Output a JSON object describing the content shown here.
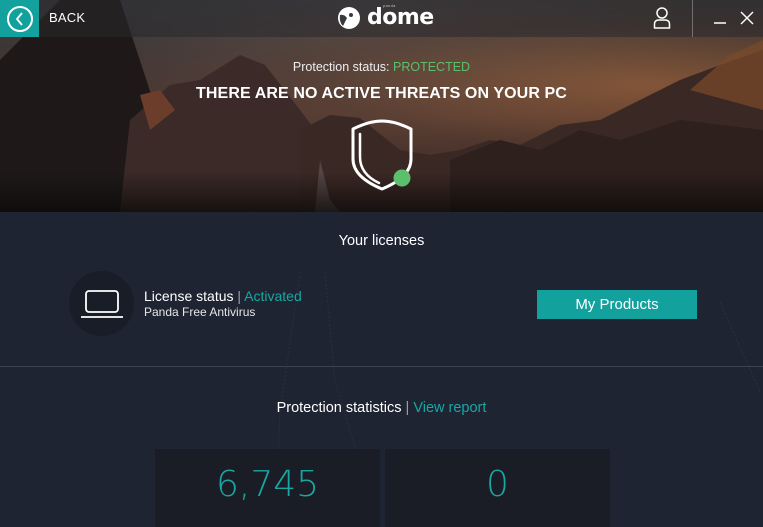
{
  "titlebar": {
    "back_label": "BACK",
    "logo_sub": "panda",
    "logo_text": "dome",
    "icons": {
      "back": "chevron-left-circle-icon",
      "user": "user-icon",
      "minimize": "minimize-icon",
      "close": "close-icon"
    }
  },
  "hero": {
    "status_label": "Protection status:",
    "status_value": "PROTECTED",
    "headline": "THERE ARE NO ACTIVE THREATS ON YOUR PC",
    "shield_icon": "shield-check-icon"
  },
  "licenses": {
    "title": "Your licenses",
    "status_label": "License status",
    "separator": "|",
    "status_value": "Activated",
    "product_name": "Panda Free Antivirus",
    "device_icon": "laptop-icon",
    "my_products_label": "My Products"
  },
  "statistics": {
    "title": "Protection statistics",
    "separator": "|",
    "view_report_label": "View report",
    "values": [
      "6,745",
      "0"
    ]
  },
  "colors": {
    "accent": "#12a19d",
    "accent_text": "#17a8a3",
    "protected_green": "#5cbf6d",
    "background": "#1f2432",
    "stat_box": "#1a1d26"
  }
}
